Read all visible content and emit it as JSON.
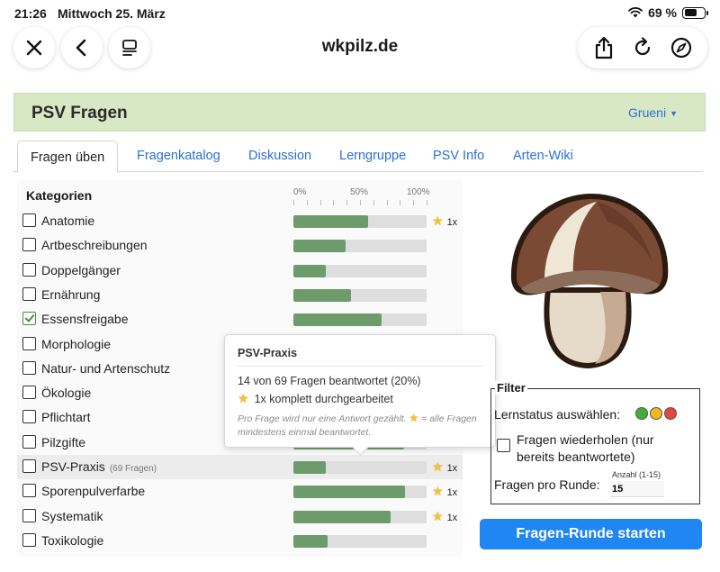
{
  "statusbar": {
    "time": "21:26",
    "date": "Mittwoch 25. März",
    "battery": "69 %",
    "battery_level": 0.69
  },
  "browser": {
    "url": "wkpilz.de",
    "icons": [
      "close-icon",
      "back-icon",
      "reader-icon",
      "share-icon",
      "reload-icon",
      "compass-icon"
    ]
  },
  "site": {
    "title": "PSV Fragen",
    "user": "Grueni",
    "header_color": "#d8e8c4"
  },
  "tabs": [
    {
      "label": "Fragen üben",
      "active": true
    },
    {
      "label": "Fragenkatalog"
    },
    {
      "label": "Diskussion"
    },
    {
      "label": "Lerngruppe"
    },
    {
      "label": "PSV Info"
    },
    {
      "label": "Arten-Wiki"
    }
  ],
  "categories": {
    "header": "Kategorien",
    "scale": [
      "0%",
      "50%",
      "100%"
    ],
    "bar_color": "#6e9b6b",
    "rows": [
      {
        "label": "Anatomie",
        "checked": false,
        "progress": 0.56,
        "badge": "1x"
      },
      {
        "label": "Artbeschreibungen",
        "checked": false,
        "progress": 0.39
      },
      {
        "label": "Doppelgänger",
        "checked": false,
        "progress": 0.24
      },
      {
        "label": "Ernährung",
        "checked": false,
        "progress": 0.43
      },
      {
        "label": "Essensfreigabe",
        "checked": true,
        "progress": 0.66
      },
      {
        "label": "Morphologie",
        "checked": false
      },
      {
        "label": "Natur- und Artenschutz",
        "checked": false
      },
      {
        "label": "Ökologie",
        "checked": false
      },
      {
        "label": "Pflichtart",
        "checked": false
      },
      {
        "label": "Pilzgifte",
        "checked": false,
        "progress": 0.83
      },
      {
        "label": "PSV-Praxis",
        "count": "(69 Fragen)",
        "checked": false,
        "progress": 0.24,
        "badge": "1x",
        "highlight": true
      },
      {
        "label": "Sporenpulverfarbe",
        "checked": false,
        "progress": 0.84,
        "badge": "1x"
      },
      {
        "label": "Systematik",
        "checked": false,
        "progress": 0.73,
        "badge": "1x"
      },
      {
        "label": "Toxikologie",
        "checked": false,
        "progress": 0.26
      }
    ]
  },
  "tooltip": {
    "title": "PSV-Praxis",
    "line1": "14 von 69 Fragen beantwortet (20%)",
    "line2": "1x komplett durchgearbeitet",
    "note_a": "Pro Frage wird nur eine Antwort gezählt.",
    "note_b": "= alle Fragen mindestens einmal beantwortet."
  },
  "filter": {
    "legend": "Filter",
    "status_label": "Lernstatus auswählen:",
    "status_colors": [
      "#3fae3a",
      "#f0b81e",
      "#e2463e"
    ],
    "repeat_label": "Fragen wiederholen (nur bereits beantwortete)",
    "repeat_checked": false,
    "count_label": "Fragen pro Runde:",
    "count_hint": "Anzahl (1-15)",
    "count_value": "15"
  },
  "start_button": "Fragen-Runde starten",
  "accent": "#1f86f2"
}
